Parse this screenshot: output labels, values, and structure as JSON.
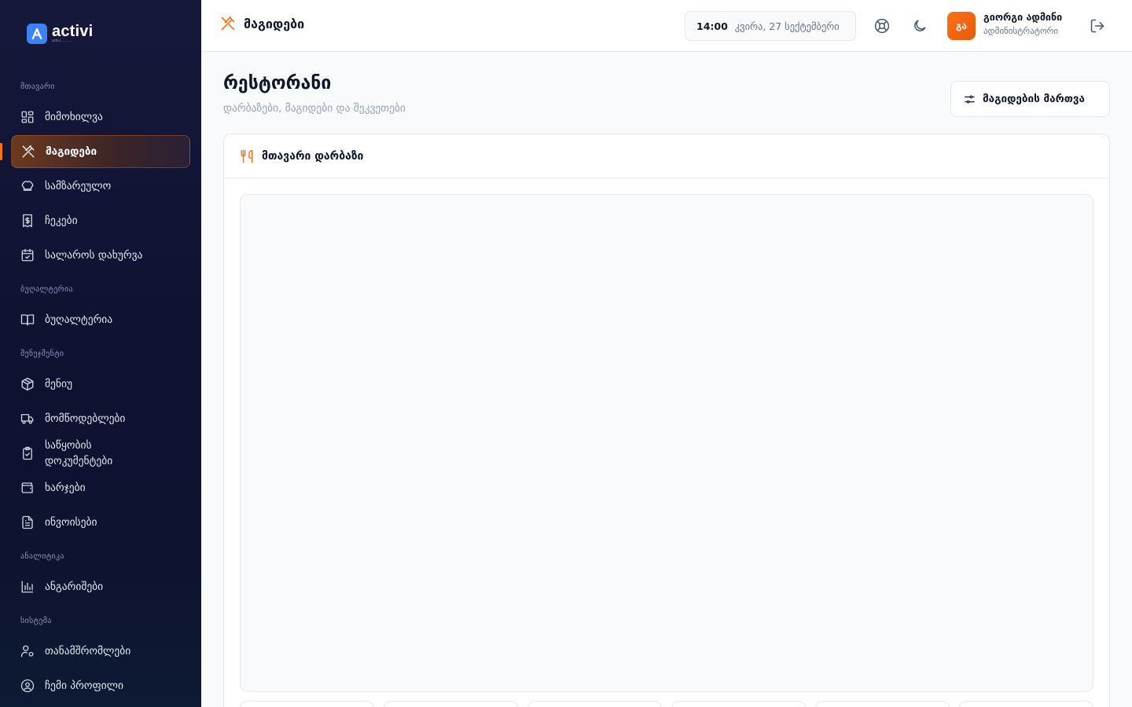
{
  "brand": {
    "name": "activi",
    "tagline": "activi ... ... ..."
  },
  "sidebar": {
    "sections": [
      {
        "label": "მთავარი",
        "items": [
          {
            "label": "მიმოხილვა",
            "icon": "dashboard-icon"
          },
          {
            "label": "მაგიდები",
            "icon": "utensils-crossed-icon",
            "active": true
          },
          {
            "label": "სამზარეულო",
            "icon": "chef-hat-icon"
          },
          {
            "label": "ჩეკები",
            "icon": "receipt-icon"
          },
          {
            "label": "სალაროს დახურვა",
            "icon": "calendar-check-icon"
          }
        ]
      },
      {
        "label": "ბუღალტერია",
        "items": [
          {
            "label": "ბუღალტერია",
            "icon": "book-open-icon"
          }
        ]
      },
      {
        "label": "მენეჯმენტი",
        "items": [
          {
            "label": "მენიუ",
            "icon": "package-icon"
          },
          {
            "label": "მომწოდებლები",
            "icon": "truck-icon"
          },
          {
            "label": "საწყობის დოკუმენტები",
            "icon": "clipboard-check-icon"
          },
          {
            "label": "ხარჯები",
            "icon": "wallet-icon"
          },
          {
            "label": "ინვოისები",
            "icon": "file-text-icon"
          }
        ]
      },
      {
        "label": "ანალიტიკა",
        "items": [
          {
            "label": "ანგარიშები",
            "icon": "bar-chart-icon"
          }
        ]
      },
      {
        "label": "სისტემა",
        "items": [
          {
            "label": "თანამშრომლები",
            "icon": "user-cog-icon"
          },
          {
            "label": "ჩემი პროფილი",
            "icon": "user-circle-icon"
          }
        ]
      }
    ]
  },
  "topbar": {
    "title": "მაგიდები",
    "time": "14:00",
    "date": "კვირა, 27 სექტემბერი",
    "user_initials": "გა",
    "user_name": "გიორგი ადმინი",
    "user_role": "ადმინისტრატორი"
  },
  "main": {
    "title": "რესტორანი",
    "subtitle": "დარბაზები, მაგიდები და შეკვეთები",
    "manage_button": "მაგიდების მართვა",
    "hall_title": "მთავარი დარბაზი"
  },
  "colors": {
    "accent": "#f97316",
    "sidebar_bg": "#14173a",
    "brand_blue": "#3b82f6"
  }
}
